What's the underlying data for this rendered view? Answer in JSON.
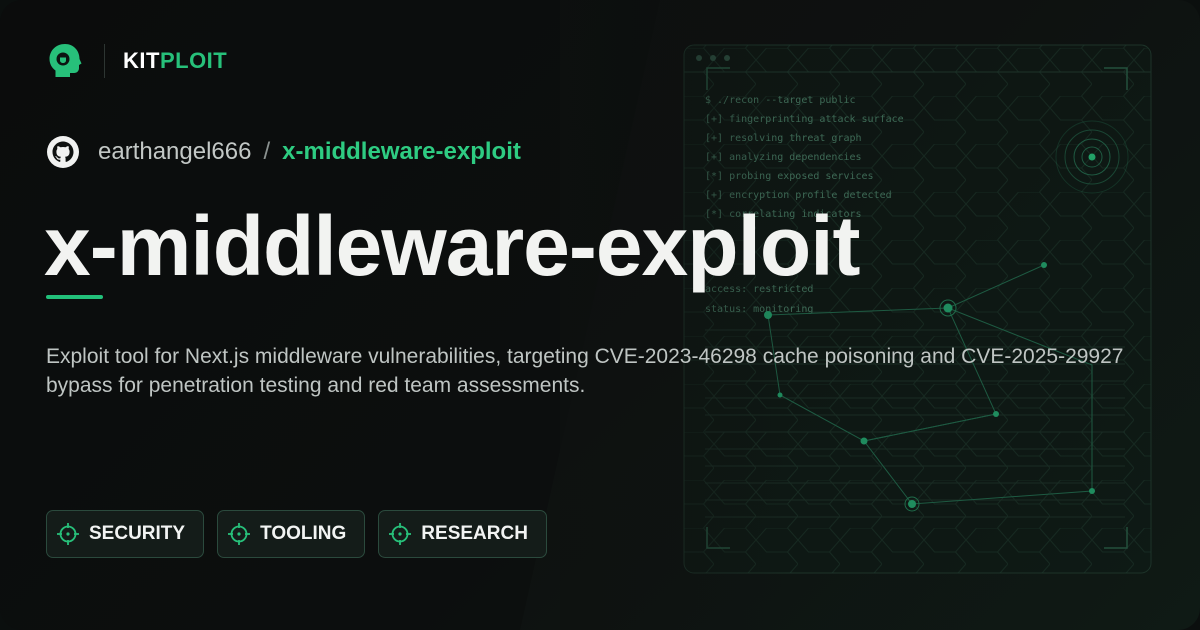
{
  "brand": {
    "kit": "KIT",
    "ploit": "PLOIT"
  },
  "breadcrumb": {
    "owner": "earthangel666",
    "separator": "/",
    "repo": "x-middleware-exploit"
  },
  "title": "x-middleware-exploit",
  "description": "Exploit tool for Next.js middleware vulnerabilities, targeting CVE-2023-46298 cache poisoning and CVE-2025-29927 bypass for penetration testing and red team assessments.",
  "tags": [
    {
      "label": "SECURITY",
      "icon": "crosshair-icon"
    },
    {
      "label": "TOOLING",
      "icon": "crosshair-icon"
    },
    {
      "label": "RESEARCH",
      "icon": "crosshair-icon"
    }
  ],
  "terminal": {
    "lines": [
      "$ ./recon --target public",
      "[+] fingerprinting attack surface",
      "[+] resolving threat graph",
      "[+] analyzing dependencies",
      "[*] probing exposed services",
      "[+] encryption profile detected",
      "[*] correlating indicators"
    ],
    "access_line": "access: restricted",
    "status_line": "status: monitoring"
  },
  "colors": {
    "accent": "#27c07a",
    "background": "#0c0d0d"
  }
}
